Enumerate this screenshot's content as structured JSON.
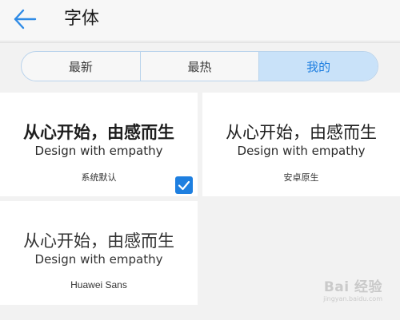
{
  "header": {
    "title": "字体",
    "back_icon": "arrow-left-icon"
  },
  "tabs": [
    {
      "label": "最新",
      "active": false
    },
    {
      "label": "最热",
      "active": false
    },
    {
      "label": "我的",
      "active": true
    }
  ],
  "colors": {
    "accent": "#1d7ee0",
    "active_tab_bg": "#c9e2f9",
    "page_bg": "#f2f2f2",
    "card_bg": "#ffffff"
  },
  "fonts": [
    {
      "sample_cn": "从心开始，由感而生",
      "sample_en": "Design with empathy",
      "name": "系统默认",
      "selected": true
    },
    {
      "sample_cn": "从心开始，由感而生",
      "sample_en": "Design with empathy",
      "name": "安卓原生",
      "selected": false
    },
    {
      "sample_cn": "从心开始，由感而生",
      "sample_en": "Design with empathy",
      "name": "Huawei Sans",
      "selected": false
    }
  ],
  "watermark": {
    "logo": "Bai 经验",
    "url": "jingyan.baidu.com"
  }
}
